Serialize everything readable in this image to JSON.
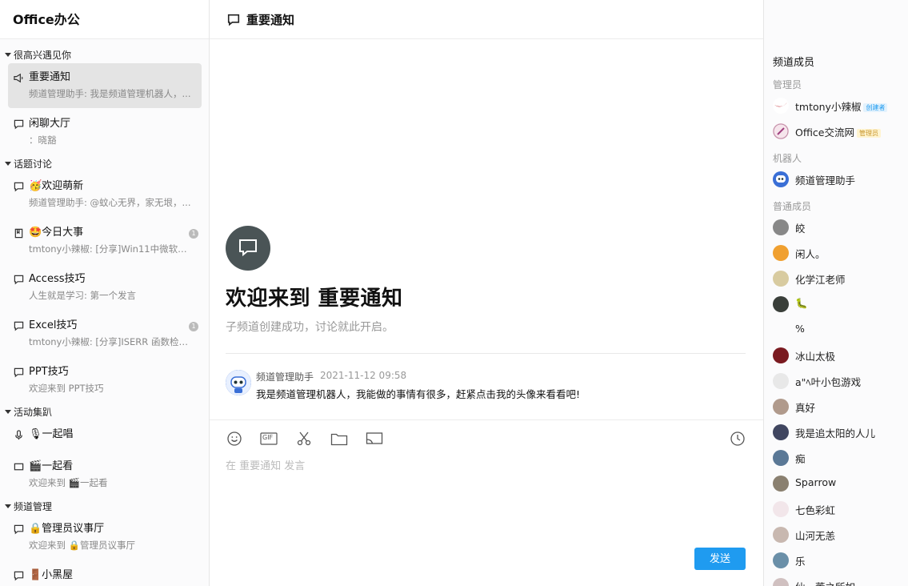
{
  "app": {
    "title": "Office办公"
  },
  "window": {
    "minimize": "—",
    "maximize": "☐",
    "close": "✕"
  },
  "header": {
    "channel_title": "重要通知"
  },
  "sidebar": {
    "groups": [
      {
        "label": "很高兴遇见你"
      },
      {
        "label": "话题讨论"
      },
      {
        "label": "活动集趴"
      },
      {
        "label": "频道管理"
      }
    ],
    "items": [
      {
        "name": "重要通知",
        "preview": "频道管理助手: 我是频道管理机器人，..."
      },
      {
        "name": "闲聊大厅",
        "preview": "：晓豁"
      },
      {
        "name": "🥳欢迎萌新",
        "preview": "频道管理助手: @蚊心无界，家无垠，..."
      },
      {
        "name": "🤩今日大事",
        "preview": "tmtony小辣椒: [分享]Win11中微软电...",
        "badge": "1"
      },
      {
        "name": "Access技巧",
        "preview": "人生就是学习: 第一个发言"
      },
      {
        "name": "Excel技巧",
        "preview": "tmtony小辣椒: [分享]ISERR 函数检查...",
        "badge": "1"
      },
      {
        "name": "PPT技巧",
        "preview": "欢迎来到 PPT技巧"
      },
      {
        "name": "🎙一起唱",
        "preview": ""
      },
      {
        "name": "🎬一起看",
        "preview": "欢迎来到 🎬一起看"
      },
      {
        "name": "🔒管理员议事厅",
        "preview": "欢迎来到 🔒管理员议事厅"
      },
      {
        "name": "🚪小黑屋",
        "preview": ""
      }
    ]
  },
  "chat": {
    "welcome_title": "欢迎来到 重要通知",
    "welcome_sub": "子频道创建成功，讨论就此开启。",
    "message": {
      "sender": "频道管理助手",
      "time": "2021-11-12 09:58",
      "text": "我是频道管理机器人，我能做的事情有很多，赶紧点击我的头像来看看吧!"
    }
  },
  "composer": {
    "placeholder": "在 重要通知 发言",
    "send_label": "发送",
    "gif_label": "GIF"
  },
  "members": {
    "title": "频道成员",
    "roles": {
      "admin": "管理员",
      "bot": "机器人",
      "normal": "普通成员"
    },
    "admins": [
      {
        "name": "tmtony小辣椒",
        "tag": "创建者",
        "tag_color": "#1f9bf0"
      },
      {
        "name": "Office交流网",
        "tag": "管理员",
        "tag_color": "#e8b200"
      }
    ],
    "bots": [
      {
        "name": "频道管理助手"
      }
    ],
    "normals": [
      {
        "name": "皎"
      },
      {
        "name": "闲人。"
      },
      {
        "name": "化学江老师"
      },
      {
        "name": "🐛"
      },
      {
        "name": "%"
      },
      {
        "name": "冰山太极"
      },
      {
        "name": "a\"ﾍ叶小包游戏"
      },
      {
        "name": "真好"
      },
      {
        "name": "我是追太阳的人儿"
      },
      {
        "name": "痴"
      },
      {
        "name": "Sparrow"
      },
      {
        "name": "七色彩虹"
      },
      {
        "name": "山河无恙"
      },
      {
        "name": "乐"
      },
      {
        "name": "仙一董之所如"
      }
    ]
  },
  "colors": {
    "accent": "#1f9bf0",
    "active_item": "#e4e4e4",
    "welcome_avatar": "#4a5456"
  }
}
